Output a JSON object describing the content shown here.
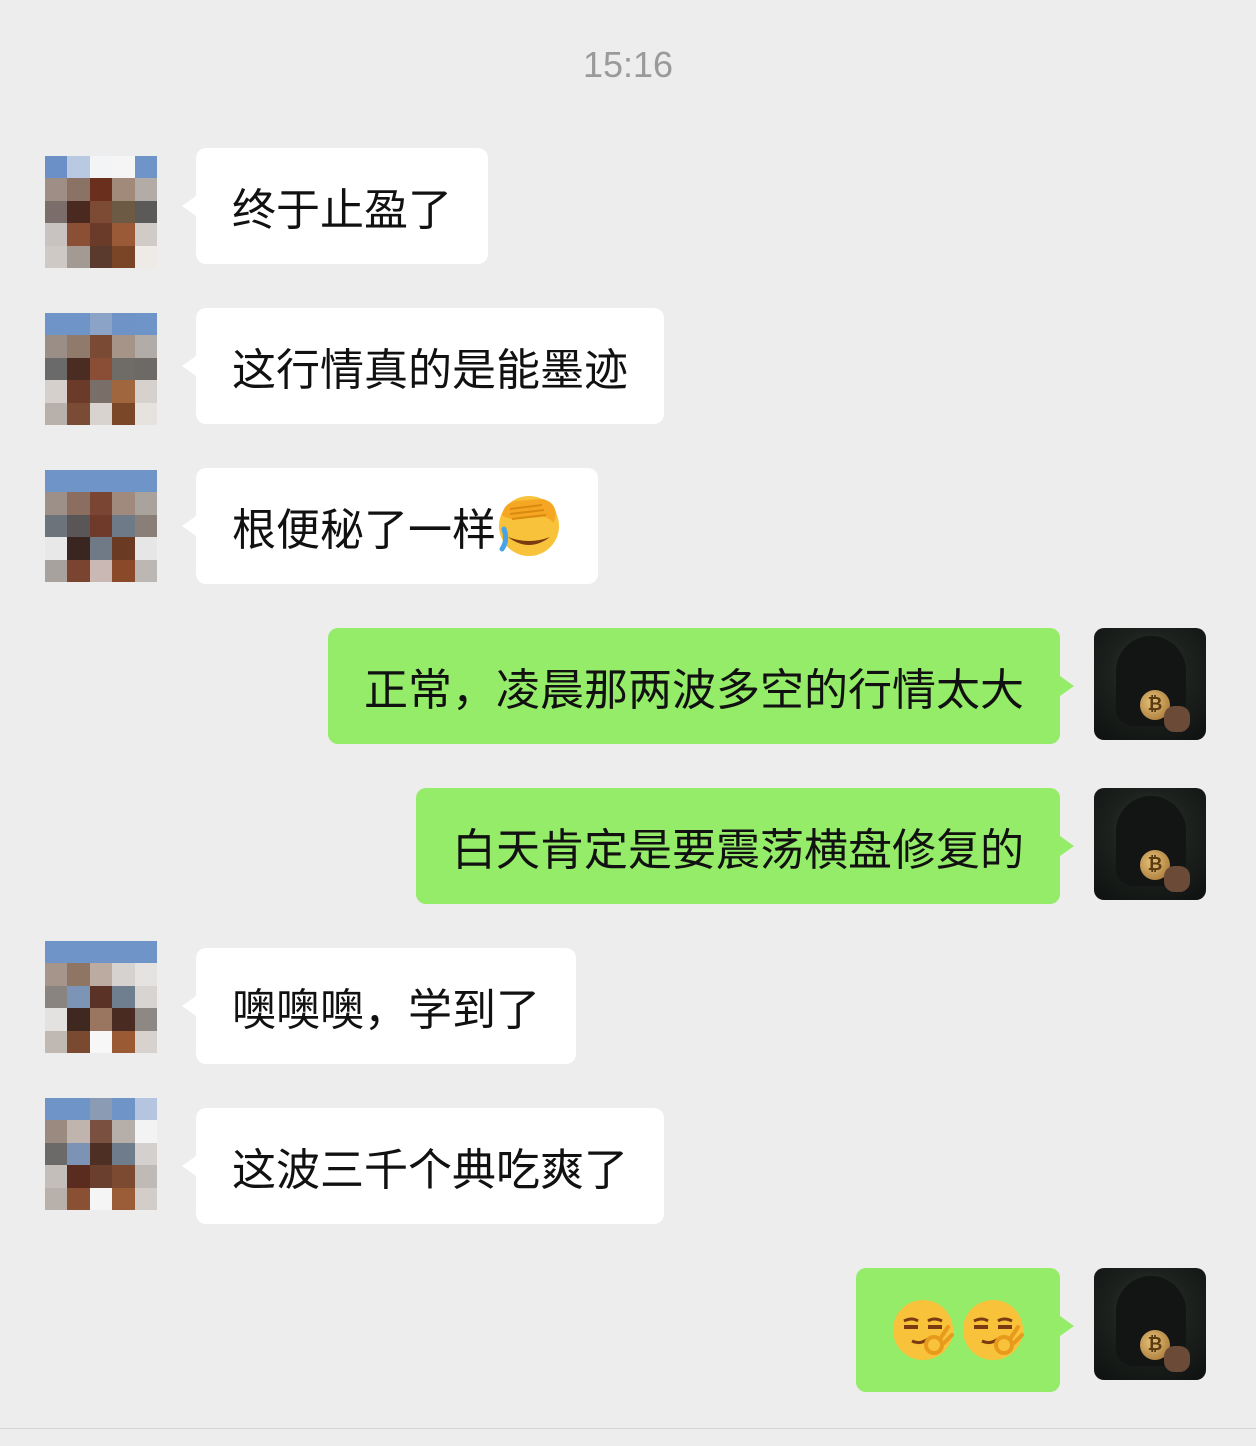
{
  "chat": {
    "timestamp": "15:16",
    "messages": [
      {
        "side": "left",
        "text": "终于止盈了"
      },
      {
        "side": "left",
        "text": "这行情真的是能墨迹"
      },
      {
        "side": "left",
        "text": "根便秘了一样",
        "emoji": "facepalm-emoji"
      },
      {
        "side": "right",
        "text": "正常，凌晨那两波多空的行情太大"
      },
      {
        "side": "right",
        "text": "白天肯定是要震荡横盘修复的"
      },
      {
        "side": "left",
        "text": "噢噢噢，学到了"
      },
      {
        "side": "left",
        "text": "这波三千个典吃爽了"
      },
      {
        "side": "right",
        "text": "",
        "emoji": "smirk-ok-emoji x2"
      }
    ]
  },
  "colors": {
    "background": "#ededed",
    "incoming_bubble": "#ffffff",
    "outgoing_bubble": "#95ec69",
    "timestamp": "#9a9a9a"
  }
}
